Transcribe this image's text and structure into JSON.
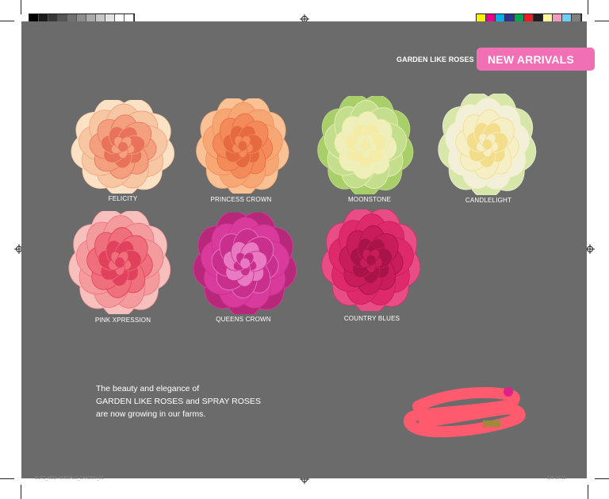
{
  "header": {
    "section_label": "GARDEN LIKE ROSES",
    "badge": "NEW ARRIVALS"
  },
  "roses": [
    {
      "name": "FELICITY",
      "colors": {
        "outer": "#f7c6a3",
        "mid": "#f4a07e",
        "inner": "#e8735a",
        "edge": "#fbe2c4"
      }
    },
    {
      "name": "PRINCESS CROWN",
      "colors": {
        "outer": "#f7a774",
        "mid": "#f48a5a",
        "inner": "#e56a3f",
        "edge": "#fac195"
      }
    },
    {
      "name": "MOONSTONE",
      "colors": {
        "outer": "#c3df8e",
        "mid": "#eeefba",
        "inner": "#f4eca6",
        "edge": "#a9cf6a"
      }
    },
    {
      "name": "CANDLELIGHT",
      "colors": {
        "outer": "#f3f0d9",
        "mid": "#f6efc6",
        "inner": "#f3dc8a",
        "edge": "#d7e6a9"
      }
    },
    {
      "name": "PINK XPRESSION",
      "colors": {
        "outer": "#f49b9e",
        "mid": "#f06f7c",
        "inner": "#e0415c",
        "edge": "#f8c0bd"
      }
    },
    {
      "name": "QUEENS CROWN",
      "colors": {
        "outer": "#d93b9c",
        "mid": "#c92f8c",
        "inner": "#e77ac2",
        "edge": "#b8287a"
      }
    },
    {
      "name": "COUNTRY BLUES",
      "colors": {
        "outer": "#de2a6a",
        "mid": "#c81d5a",
        "inner": "#a81448",
        "edge": "#e94d86"
      }
    }
  ],
  "tagline": {
    "line1": "The beauty and elegance of",
    "line2": "GARDEN LIKE ROSES and SPRAY ROSES",
    "line3": "are now growing in our farms."
  },
  "slug": {
    "left": "ELITE_NEW ARRIVALS_GARDEN_01",
    "right": "1/3 10:12"
  },
  "colors": {
    "page_background": "#6b6b6b",
    "badge": "#f06fb5",
    "redaction": "#ff5a6e"
  }
}
